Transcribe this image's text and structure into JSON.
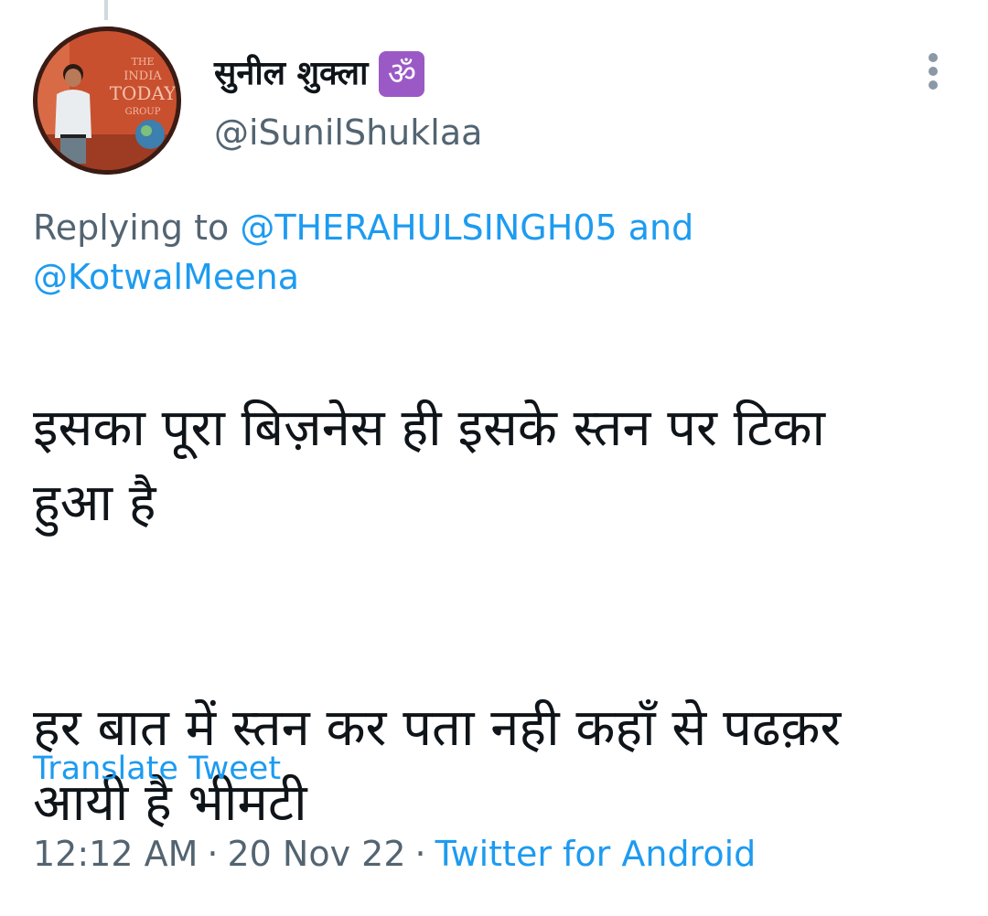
{
  "tweet": {
    "author": {
      "display_name": "सुनील शुक्ला",
      "badge_glyph": "ॐ",
      "badge_color": "#9b59c6",
      "handle": "@iSunilShuklaa",
      "avatar_sign_text": [
        "THE",
        "INDIA",
        "TODAY",
        "GROUP"
      ]
    },
    "replying": {
      "prefix": "Replying to",
      "mention_1": "@THERAHULSINGH05",
      "joiner": "and",
      "mention_2": "@KotwalMeena"
    },
    "text": {
      "paragraph_1": "इसका पूरा बिज़नेस ही इसके स्तन पर टिका\nहुआ है",
      "paragraph_2": "हर बात में स्तन कर पता नही कहाँ से पढक़र\nआयी है भीमटी"
    },
    "translate_label": "Translate Tweet",
    "meta": {
      "time": "12:12 AM",
      "separator": "·",
      "date": "20 Nov 22",
      "source": "Twitter for Android"
    },
    "icons": {
      "more": "more-vertical-icon"
    },
    "colors": {
      "link": "#1d9bf0",
      "secondary_text": "#536471",
      "primary_text": "#0f1419"
    }
  }
}
